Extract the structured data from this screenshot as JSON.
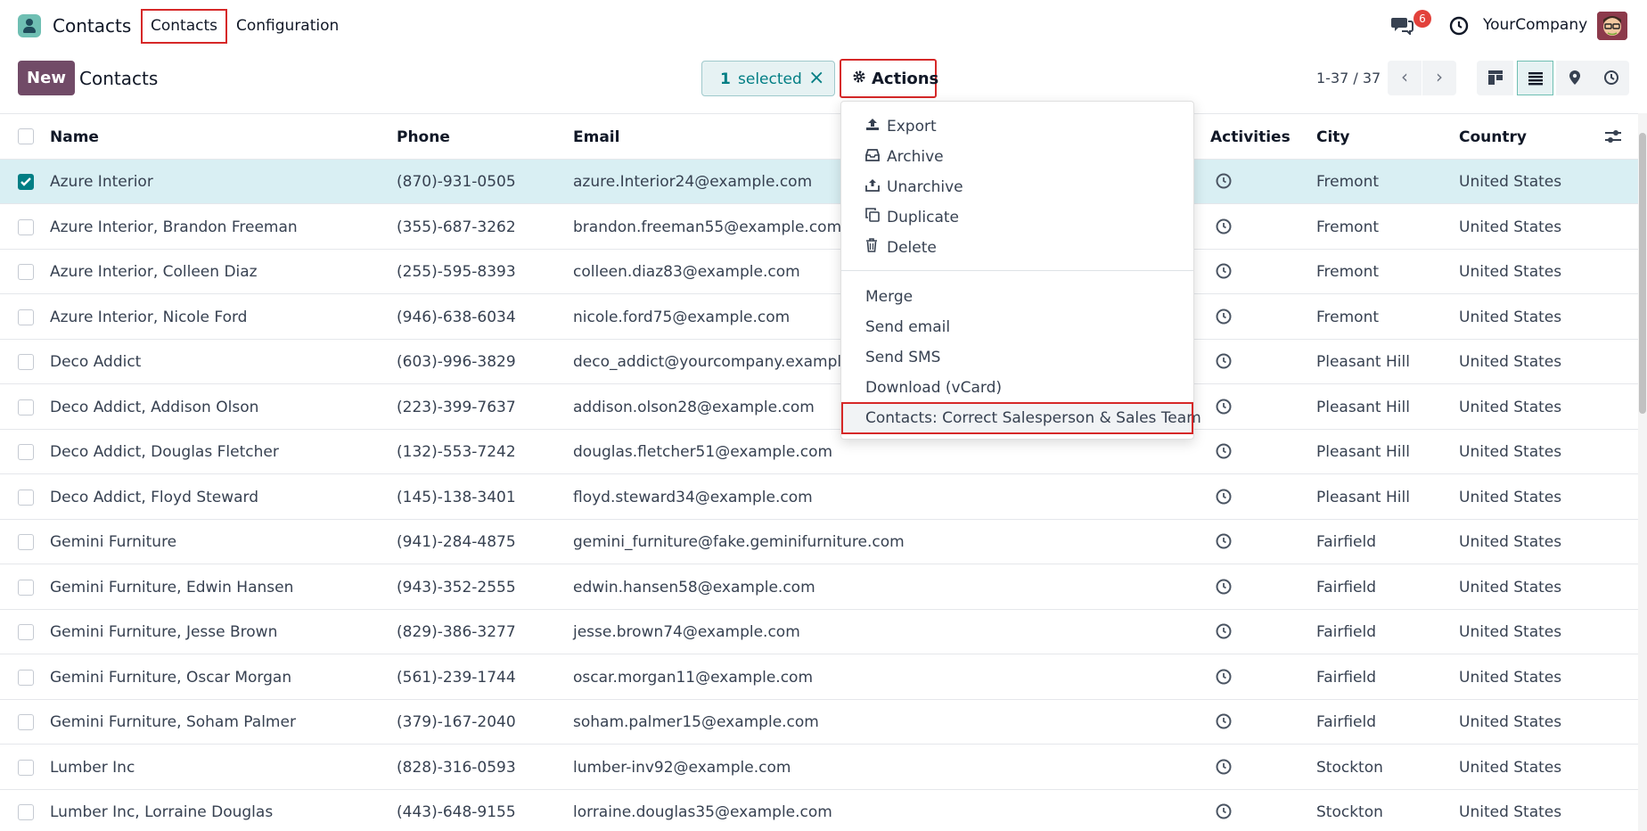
{
  "navbar": {
    "app_name": "Contacts",
    "menu": [
      {
        "label": "Contacts"
      },
      {
        "label": "Configuration"
      }
    ],
    "chat_badge": "6",
    "company": "YourCompany"
  },
  "control_panel": {
    "new_label": "New",
    "title": "Contacts",
    "selected_count": "1",
    "selected_label": "selected",
    "actions_label": "Actions",
    "pager": "1-37 / 37"
  },
  "actions_menu": {
    "items": [
      {
        "label": "Export",
        "icon": "upload-icon"
      },
      {
        "label": "Archive",
        "icon": "archive-icon"
      },
      {
        "label": "Unarchive",
        "icon": "unarchive-icon"
      },
      {
        "label": "Duplicate",
        "icon": "copy-icon"
      },
      {
        "label": "Delete",
        "icon": "trash-icon"
      },
      {
        "label": "Merge"
      },
      {
        "label": "Send email"
      },
      {
        "label": "Send SMS"
      },
      {
        "label": "Download (vCard)"
      },
      {
        "label": "Contacts: Correct Salesperson & Sales Team"
      }
    ]
  },
  "table": {
    "headers": {
      "name": "Name",
      "phone": "Phone",
      "email": "Email",
      "activities": "Activities",
      "city": "City",
      "country": "Country"
    },
    "rows": [
      {
        "name": "Azure Interior",
        "phone": "(870)-931-0505",
        "email": "azure.Interior24@example.com",
        "city": "Fremont",
        "country": "United States",
        "selected": true
      },
      {
        "name": "Azure Interior, Brandon Freeman",
        "phone": "(355)-687-3262",
        "email": "brandon.freeman55@example.com",
        "city": "Fremont",
        "country": "United States"
      },
      {
        "name": "Azure Interior, Colleen Diaz",
        "phone": "(255)-595-8393",
        "email": "colleen.diaz83@example.com",
        "city": "Fremont",
        "country": "United States"
      },
      {
        "name": "Azure Interior, Nicole Ford",
        "phone": "(946)-638-6034",
        "email": "nicole.ford75@example.com",
        "city": "Fremont",
        "country": "United States"
      },
      {
        "name": "Deco Addict",
        "phone": "(603)-996-3829",
        "email": "deco_addict@yourcompany.example.c",
        "city": "Pleasant Hill",
        "country": "United States"
      },
      {
        "name": "Deco Addict, Addison Olson",
        "phone": "(223)-399-7637",
        "email": "addison.olson28@example.com",
        "city": "Pleasant Hill",
        "country": "United States"
      },
      {
        "name": "Deco Addict, Douglas Fletcher",
        "phone": "(132)-553-7242",
        "email": "douglas.fletcher51@example.com",
        "city": "Pleasant Hill",
        "country": "United States"
      },
      {
        "name": "Deco Addict, Floyd Steward",
        "phone": "(145)-138-3401",
        "email": "floyd.steward34@example.com",
        "city": "Pleasant Hill",
        "country": "United States"
      },
      {
        "name": "Gemini Furniture",
        "phone": "(941)-284-4875",
        "email": "gemini_furniture@fake.geminifurniture.com",
        "city": "Fairfield",
        "country": "United States"
      },
      {
        "name": "Gemini Furniture, Edwin Hansen",
        "phone": "(943)-352-2555",
        "email": "edwin.hansen58@example.com",
        "city": "Fairfield",
        "country": "United States"
      },
      {
        "name": "Gemini Furniture, Jesse Brown",
        "phone": "(829)-386-3277",
        "email": "jesse.brown74@example.com",
        "city": "Fairfield",
        "country": "United States"
      },
      {
        "name": "Gemini Furniture, Oscar Morgan",
        "phone": "(561)-239-1744",
        "email": "oscar.morgan11@example.com",
        "city": "Fairfield",
        "country": "United States"
      },
      {
        "name": "Gemini Furniture, Soham Palmer",
        "phone": "(379)-167-2040",
        "email": "soham.palmer15@example.com",
        "city": "Fairfield",
        "country": "United States"
      },
      {
        "name": "Lumber Inc",
        "phone": "(828)-316-0593",
        "email": "lumber-inv92@example.com",
        "city": "Stockton",
        "country": "United States"
      },
      {
        "name": "Lumber Inc, Lorraine Douglas",
        "phone": "(443)-648-9155",
        "email": "lorraine.douglas35@example.com",
        "city": "Stockton",
        "country": "United States"
      }
    ]
  },
  "colors": {
    "brand": "#714b67",
    "accent": "#017e84",
    "highlight_outline": "#d62828",
    "selected_row": "#d9eff3"
  }
}
